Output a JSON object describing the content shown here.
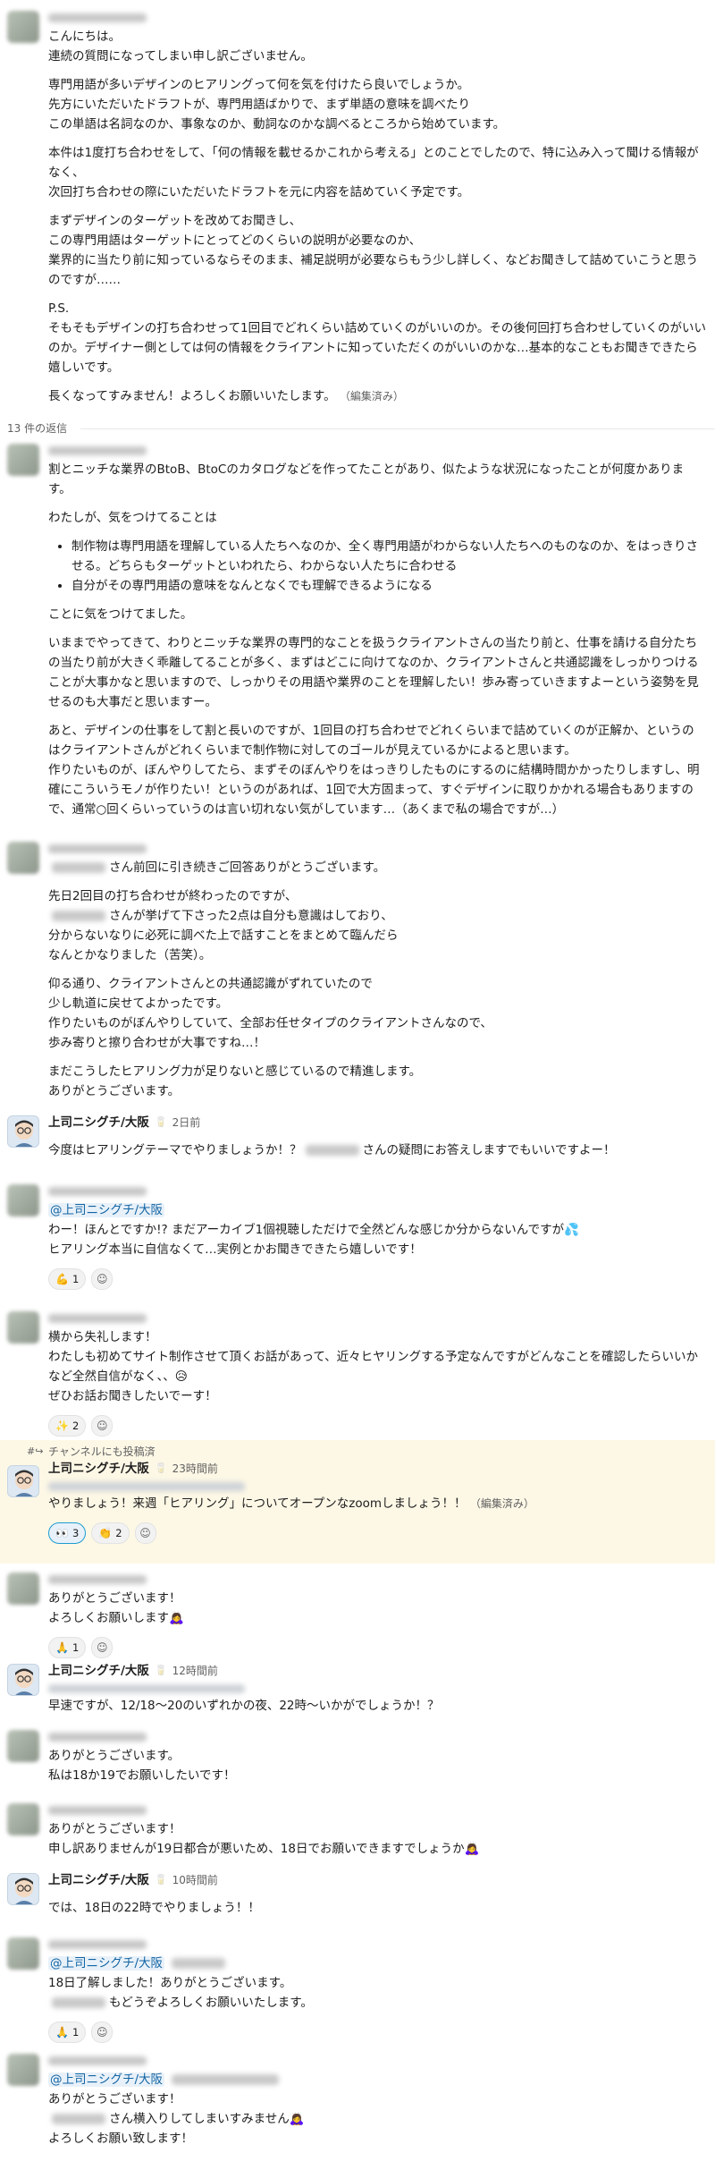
{
  "thread": {
    "parent": {
      "p1": "こんにちは。\n連続の質問になってしまい申し訳ございません。",
      "p2": "専門用語が多いデザインのヒアリングって何を気を付けたら良いでしょうか。\n先方にいただいたドラフトが、専門用語ばかりで、まず単語の意味を調べたり\nこの単語は名詞なのか、事象なのか、動詞なのかな調べるところから始めています。",
      "p3": "本件は1度打ち合わせをして、「何の情報を載せるかこれから考える」とのことでしたので、特に込み入って聞ける情報がなく、\n次回打ち合わせの際にいただいたドラフトを元に内容を詰めていく予定です。",
      "p4": "まずデザインのターゲットを改めてお聞きし、\nこの専門用語はターゲットにとってどのくらいの説明が必要なのか、\n業界的に当たり前に知っているならそのまま、補足説明が必要ならもう少し詳しく、などお聞きして詰めていこうと思うのですが……",
      "p5": "P.S.\nそもそもデザインの打ち合わせって1回目でどれくらい詰めていくのがいいのか。その後何回打ち合わせしていくのがいいのか。デザイナー側としては何の情報をクライアントに知っていただくのがいいのかな…基本的なこともお聞きできたら嬉しいです。",
      "p6": "長くなってすみません！よろしくお願いいたします。",
      "edited": "（編集済み）"
    },
    "replies_count": "13 件の返信",
    "r1": {
      "p1": "割とニッチな業界のBtoB、BtoCのカタログなどを作ってたことがあり、似たような状況になったことが何度かあります。",
      "p2": "わたしが、気をつけてることは",
      "li1": "制作物は専門用語を理解している人たちへなのか、全く専門用語がわからない人たちへのものなのか、をはっきりさせる。どちらもターゲットといわれたら、わからない人たちに合わせる",
      "li2": "自分がその専門用語の意味をなんとなくでも理解できるようになる",
      "p3": "ことに気をつけてました。",
      "p4": "いままでやってきて、わりとニッチな業界の専門的なことを扱うクライアントさんの当たり前と、仕事を請ける自分たちの当たり前が大きく乖離してることが多く、まずはどこに向けてなのか、クライアントさんと共通認識をしっかりつけることが大事かなと思いますので、しっかりその用語や業界のことを理解したい！歩み寄っていきますよーという姿勢を見せるのも大事だと思いますー。",
      "p5": "あと、デザインの仕事をして割と長いのですが、1回目の打ち合わせでどれくらいまで詰めていくのが正解か、というのはクライアントさんがどれくらいまで制作物に対してのゴールが見えているかによると思います。\n作りたいものが、ぼんやりしてたら、まずそのぼんやりをはっきりしたものにするのに結構時間かかったりしますし、明確にこういうモノが作りたい！というのがあれば、1回で大方固まって、すぐデザインに取りかかれる場合もありますので、通常○回くらいっていうのは言い切れない気がしています…（あくまで私の場合ですが…）"
    },
    "r2": {
      "p1a": "さん前回に引き続きご回答ありがとうございます。",
      "p2a": "先日2回目の打ち合わせが終わったのですが、",
      "p2b": "さんが挙げて下さった2点は自分も意識はしており、\n分からないなりに必死に調べた上で話すことをまとめて臨んだら\nなんとかなりました（苦笑）。",
      "p3": "仰る通り、クライアントさんとの共通認識がずれていたので\n少し軌道に戻せてよかったです。\n作りたいものがぼんやりしていて、全部お任せタイプのクライアントさんなので、\n歩み寄りと擦り合わせが大事ですね…！",
      "p4": "まだこうしたヒアリング力が足りないと感じているので精進します。\nありがとうございます。"
    },
    "r3": {
      "name": "上司ニシグチ/大阪",
      "time": "2日前",
      "p1a": "今度はヒアリングテーマでやりましょうか！？",
      "p1b": "さんの疑問にお答えしますでもいいですよー！"
    },
    "r4": {
      "mention": "@上司ニシグチ/大阪",
      "p1": "わー！ほんとですか!? まだアーカイブ1個視聴しただけで全然どんな感じか分からないんですが💦\nヒアリング本当に自信なくて…実例とかお聞きできたら嬉しいです！",
      "react1_emoji": "💪",
      "react1_count": "1"
    },
    "r5": {
      "p1": "横から失礼します！\nわたしも初めてサイト制作させて頂くお話があって、近々ヒヤリングする予定なんですがどんなことを確認したらいいかなど全然自信がなく、、😥\nぜひお話お聞きしたいでーす！",
      "react1_emoji": "✨",
      "react1_count": "2"
    },
    "r6": {
      "channel_note": "チャンネルにも投稿済",
      "name": "上司ニシグチ/大阪",
      "time": "23時間前",
      "p1": "やりましょう！来週「ヒアリング」についてオープンなzoomしましょう！！",
      "edited": "（編集済み）",
      "react1_emoji": "👀",
      "react1_count": "3",
      "react2_emoji": "👏",
      "react2_count": "2"
    },
    "r7": {
      "p1": "ありがとうございます！\nよろしくお願いします🙇‍♀️",
      "react1_emoji": "🙏",
      "react1_count": "1"
    },
    "r8": {
      "name": "上司ニシグチ/大阪",
      "time": "12時間前",
      "p1": "早速ですが、12/18〜20のいずれかの夜、22時〜いかがでしょうか！？"
    },
    "r9": {
      "p1": "ありがとうございます。\n私は18か19でお願いしたいです！"
    },
    "r10": {
      "p1": "ありがとうございます！\n申し訳ありませんが19日都合が悪いため、18日でお願いできますでしょうか🙇‍♀️"
    },
    "r11": {
      "name": "上司ニシグチ/大阪",
      "time": "10時間前",
      "p1": "では、18日の22時でやりましょう！！"
    },
    "r12": {
      "mention": "@上司ニシグチ/大阪",
      "p1": "18日了解しました！ありがとうございます。",
      "p2": "もどうぞよろしくお願いいたします。",
      "react1_emoji": "🙏",
      "react1_count": "1"
    },
    "r13": {
      "mention": "@上司ニシグチ/大阪",
      "p1": "ありがとうございます！",
      "p2": "さん横入りしてしまいすみません🙇‍♀️",
      "p3": "よろしくお願い致します！"
    }
  }
}
